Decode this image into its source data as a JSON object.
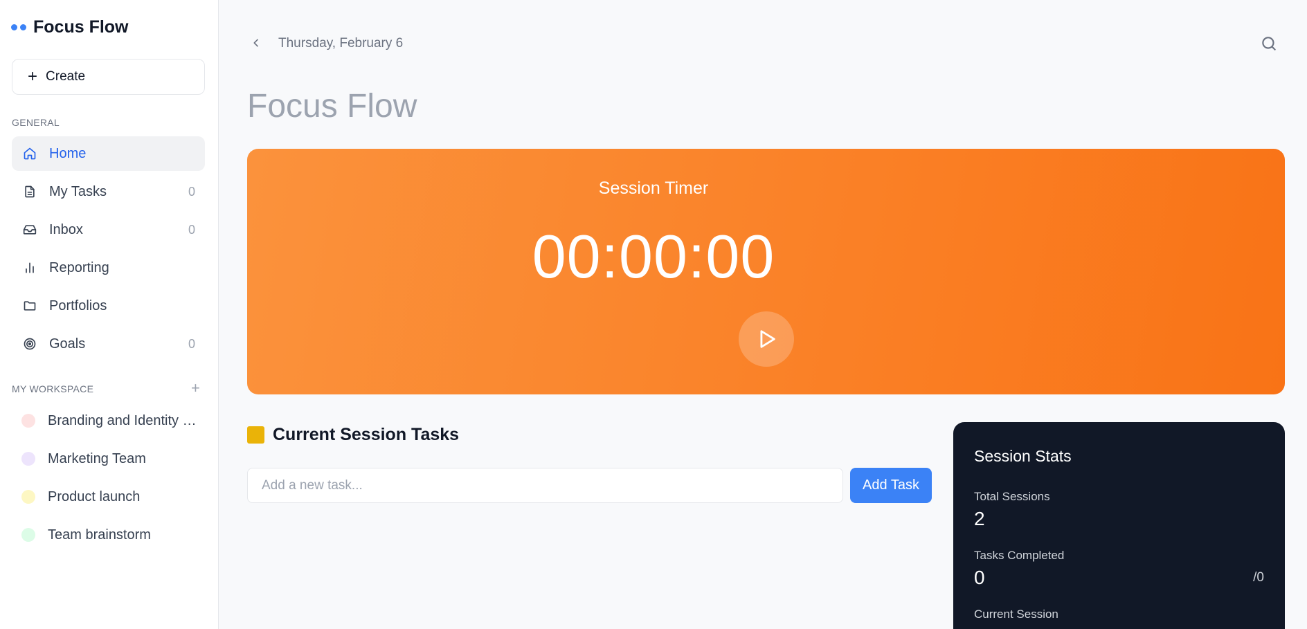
{
  "app": {
    "title": "Focus Flow",
    "accent": "#3b82f6"
  },
  "sidebar": {
    "create_label": "Create",
    "general_label": "GENERAL",
    "nav": [
      {
        "label": "Home",
        "icon": "home-icon",
        "count": ""
      },
      {
        "label": "My Tasks",
        "icon": "document-icon",
        "count": "0"
      },
      {
        "label": "Inbox",
        "icon": "inbox-icon",
        "count": "0"
      },
      {
        "label": "Reporting",
        "icon": "bar-chart-icon",
        "count": ""
      },
      {
        "label": "Portfolios",
        "icon": "folder-icon",
        "count": ""
      },
      {
        "label": "Goals",
        "icon": "target-icon",
        "count": "0"
      }
    ],
    "workspace_label": "MY WORKSPACE",
    "workspace": [
      {
        "label": "Branding and Identity Refresh",
        "color": "#fde2e2"
      },
      {
        "label": "Marketing Team",
        "color": "#ede4fc"
      },
      {
        "label": "Product launch",
        "color": "#fdf7c3"
      },
      {
        "label": "Team brainstorm",
        "color": "#dcfce7"
      }
    ]
  },
  "header": {
    "date": "Thursday, February 6",
    "page_title": "Focus Flow"
  },
  "timer": {
    "label": "Session Timer",
    "value": "00:00:00",
    "color_start": "#fb923c",
    "color_end": "#f97316"
  },
  "tasks": {
    "heading": "Current Session Tasks",
    "input_placeholder": "Add a new task...",
    "add_button": "Add Task"
  },
  "stats": {
    "title": "Session Stats",
    "total_sessions_label": "Total Sessions",
    "total_sessions_value": "2",
    "tasks_completed_label": "Tasks Completed",
    "tasks_completed_value": "0",
    "tasks_completed_total": "/0",
    "current_session_label": "Current Session"
  }
}
